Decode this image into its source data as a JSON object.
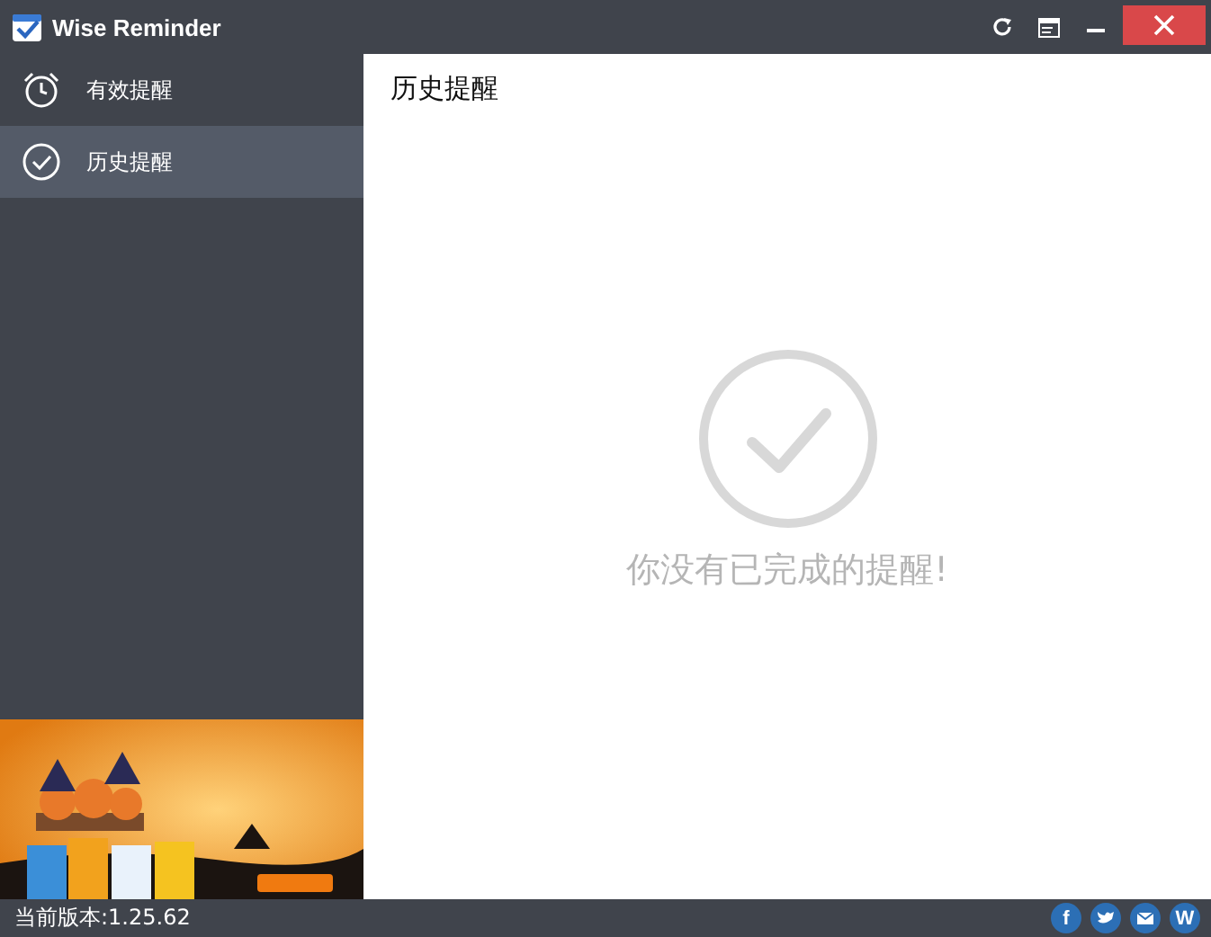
{
  "window": {
    "title": "Wise Reminder"
  },
  "sidebar": {
    "items": [
      {
        "label": "有效提醒",
        "kind": "alarm",
        "selected": false
      },
      {
        "label": "历史提醒",
        "kind": "check",
        "selected": true
      }
    ]
  },
  "content": {
    "title": "历史提醒",
    "empty_message": "你没有已完成的提醒!"
  },
  "status_bar": {
    "version": "当前版本:1.25.62",
    "social_links": [
      {
        "kind": "facebook",
        "label": "f"
      },
      {
        "kind": "twitter"
      },
      {
        "kind": "mail"
      },
      {
        "kind": "wise",
        "label": "W"
      }
    ]
  }
}
